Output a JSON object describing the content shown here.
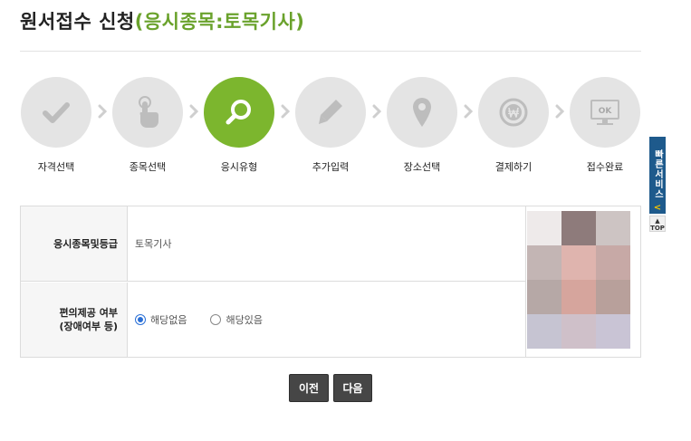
{
  "page": {
    "title_main": "원서접수 신청",
    "title_accent": "(응시종목:토목기사)"
  },
  "steps": [
    {
      "label": "자격선택",
      "icon": "check-icon",
      "active": false
    },
    {
      "label": "종목선택",
      "icon": "hand-pointer-icon",
      "active": false
    },
    {
      "label": "응시유형",
      "icon": "magnifier-icon",
      "active": true
    },
    {
      "label": "추가입력",
      "icon": "pencil-icon",
      "active": false
    },
    {
      "label": "장소선택",
      "icon": "map-pin-icon",
      "active": false
    },
    {
      "label": "결제하기",
      "icon": "won-coin-icon",
      "active": false
    },
    {
      "label": "접수완료",
      "icon": "monitor-ok-icon",
      "active": false,
      "icon_text": "OK"
    }
  ],
  "form": {
    "exam_label": "응시종목및등급",
    "exam_value": "토목기사",
    "accommodation_label_1": "편의제공 여부",
    "accommodation_label_2": "(장애여부 등)",
    "options": [
      {
        "label": "해당없음",
        "checked": true
      },
      {
        "label": "해당있음",
        "checked": false
      }
    ]
  },
  "photo": {
    "mosaic_colors": [
      "#eeeaea",
      "#8e7b7b",
      "#cdc4c3",
      "#c3b5b4",
      "#dfb4ae",
      "#c7a9a6",
      "#b6a8a6",
      "#d6a59d",
      "#b8a09b",
      "#c6c4d2",
      "#cfc0c9",
      "#c9c4d5"
    ]
  },
  "sidebar": {
    "quick_label": "빠른서비스",
    "quick_arrow": "<",
    "top_label": "TOP"
  },
  "buttons": {
    "prev_label": "이전",
    "next_label": "다음"
  },
  "colors": {
    "accent": "#6aa22c",
    "step_active": "#7cb62e",
    "step_inactive": "#e4e4e4",
    "button_dark": "#464646",
    "quick_service_blue": "#1e5a8c"
  }
}
